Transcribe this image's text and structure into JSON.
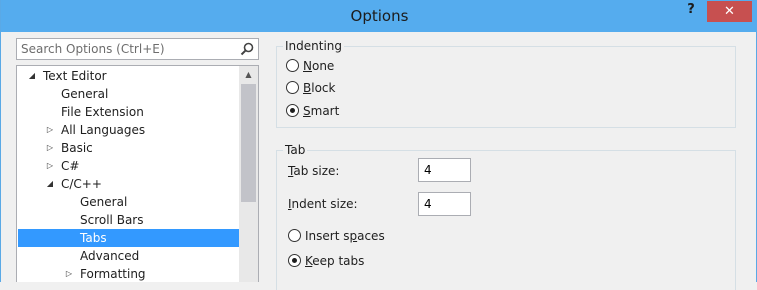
{
  "window": {
    "title": "Options",
    "help_label": "?",
    "close_label": "✕"
  },
  "search": {
    "placeholder": "Search Options (Ctrl+E)"
  },
  "tree": {
    "items": [
      {
        "label": "Text Editor",
        "arrow": "◢",
        "selected": false
      },
      {
        "label": "General",
        "arrow": "",
        "selected": false
      },
      {
        "label": "File Extension",
        "arrow": "",
        "selected": false
      },
      {
        "label": "All Languages",
        "arrow": "▷",
        "selected": false
      },
      {
        "label": "Basic",
        "arrow": "▷",
        "selected": false
      },
      {
        "label": "C#",
        "arrow": "▷",
        "selected": false
      },
      {
        "label": "C/C++",
        "arrow": "◢",
        "selected": false
      },
      {
        "label": "General",
        "arrow": "",
        "selected": false
      },
      {
        "label": "Scroll Bars",
        "arrow": "",
        "selected": false
      },
      {
        "label": "Tabs",
        "arrow": "",
        "selected": true
      },
      {
        "label": "Advanced",
        "arrow": "",
        "selected": false
      },
      {
        "label": "Formatting",
        "arrow": "▷",
        "selected": false
      }
    ],
    "scroll_up": "▲"
  },
  "indenting": {
    "title": "Indenting",
    "options": [
      {
        "key": "N",
        "rest": "one",
        "checked": false
      },
      {
        "key": "B",
        "rest": "lock",
        "checked": false
      },
      {
        "key": "S",
        "rest": "mart",
        "checked": true
      }
    ]
  },
  "tab": {
    "title": "Tab",
    "tab_size": {
      "key": "T",
      "rest": "ab size:",
      "value": "4"
    },
    "indent_size": {
      "key": "I",
      "rest": "ndent size:",
      "value": "4"
    },
    "insert_spaces": {
      "pre": "Insert s",
      "key": "p",
      "post": "aces",
      "checked": false
    },
    "keep_tabs": {
      "key": "K",
      "rest": "eep tabs",
      "checked": true
    }
  }
}
